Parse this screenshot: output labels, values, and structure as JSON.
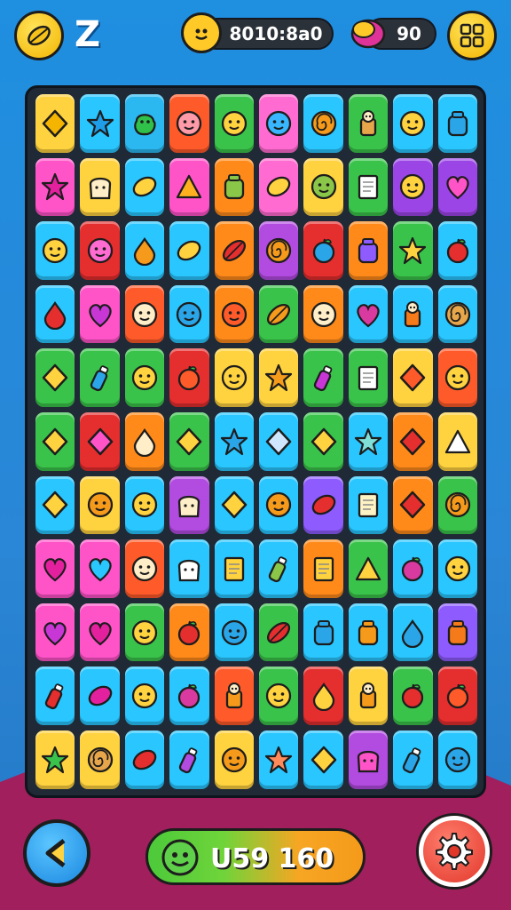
{
  "hud": {
    "top_letter": "Z",
    "score_pill_value": "8010:8a0",
    "gems_pill_value": "90"
  },
  "bottom": {
    "score_value": "U59 160"
  },
  "board": {
    "rows": [
      [
        [
          "#ffd23f",
          "diamond",
          "#f4b400"
        ],
        [
          "#29c6ff",
          "star",
          "#1e9ee8"
        ],
        [
          "#2bb8f0",
          "blob",
          "#2fc14a"
        ],
        [
          "#ff5a2a",
          "face",
          "#ff9aa8"
        ],
        [
          "#3ac34a",
          "face",
          "#ffd23f"
        ],
        [
          "#ff6bd0",
          "face",
          "#38b6ff"
        ],
        [
          "#29c6ff",
          "spiral",
          "#f59a1a"
        ],
        [
          "#3ac34a",
          "figure",
          "#e8a64a"
        ],
        [
          "#29c6ff",
          "face",
          "#ffd23f"
        ],
        [
          "#29c6ff",
          "jar",
          "#2aa6e8"
        ]
      ],
      [
        [
          "#ff53c8",
          "star",
          "#e3209e"
        ],
        [
          "#ffd23f",
          "toast",
          "#ffeec7"
        ],
        [
          "#29c6ff",
          "bean",
          "#ffd23f"
        ],
        [
          "#ff53c8",
          "triangle",
          "#ffb01f"
        ],
        [
          "#ff8a1a",
          "jar",
          "#8ac648"
        ],
        [
          "#ff6bd0",
          "bean",
          "#ffd23f"
        ],
        [
          "#ffd23f",
          "face",
          "#8ac648"
        ],
        [
          "#3ac34a",
          "card",
          "#ffffff"
        ],
        [
          "#9b45e6",
          "face",
          "#ffd23f"
        ],
        [
          "#9b45e6",
          "heart",
          "#ff53c8"
        ]
      ],
      [
        [
          "#29c6ff",
          "face",
          "#ffd23f"
        ],
        [
          "#e52e2e",
          "face",
          "#ff6bd0"
        ],
        [
          "#29c6ff",
          "drop",
          "#f59a1a"
        ],
        [
          "#29c6ff",
          "bean",
          "#ffd23f"
        ],
        [
          "#ff8a1a",
          "leaf",
          "#e52e2e"
        ],
        [
          "#b24be0",
          "spiral",
          "#f59a1a"
        ],
        [
          "#e52e2e",
          "apple",
          "#2aa6e8"
        ],
        [
          "#ff8a1a",
          "jar",
          "#8e5bff"
        ],
        [
          "#3ac34a",
          "star",
          "#ffd23f"
        ],
        [
          "#29c6ff",
          "apple",
          "#e52e2e"
        ]
      ],
      [
        [
          "#29c6ff",
          "drop",
          "#e52e2e"
        ],
        [
          "#ff53c8",
          "heart",
          "#c837d6"
        ],
        [
          "#ff5a2a",
          "face",
          "#ffeec7"
        ],
        [
          "#29c6ff",
          "face",
          "#2aa6e8"
        ],
        [
          "#ff8a1a",
          "face",
          "#ff5a2a"
        ],
        [
          "#3ac34a",
          "leaf",
          "#f59a1a"
        ],
        [
          "#ff8a1a",
          "face",
          "#ffeec7"
        ],
        [
          "#29c6ff",
          "heart",
          "#d83aa0"
        ],
        [
          "#29c6ff",
          "figure",
          "#f57a1a"
        ],
        [
          "#29c6ff",
          "spiral",
          "#e8a64a"
        ]
      ],
      [
        [
          "#3ac34a",
          "diamond",
          "#ffd23f"
        ],
        [
          "#3ac34a",
          "bottle",
          "#2aa6e8"
        ],
        [
          "#3ac34a",
          "face",
          "#ffd23f"
        ],
        [
          "#e52e2e",
          "apple",
          "#ff5a2a"
        ],
        [
          "#ffd23f",
          "face",
          "#ffd23f"
        ],
        [
          "#ffd23f",
          "star",
          "#f59a1a"
        ],
        [
          "#3ac34a",
          "bottle",
          "#c837d6"
        ],
        [
          "#3ac34a",
          "card",
          "#ffffff"
        ],
        [
          "#ffd23f",
          "diamond",
          "#ff5a2a"
        ],
        [
          "#ff5a2a",
          "face",
          "#ffd23f"
        ]
      ],
      [
        [
          "#3ac34a",
          "diamond",
          "#ffd23f"
        ],
        [
          "#e52e2e",
          "diamond",
          "#ff53c8"
        ],
        [
          "#ff8a1a",
          "drop",
          "#ffeec7"
        ],
        [
          "#3ac34a",
          "diamond",
          "#ffd23f"
        ],
        [
          "#29c6ff",
          "star",
          "#2aa6e8"
        ],
        [
          "#29c6ff",
          "diamond",
          "#cfe6ff"
        ],
        [
          "#3ac34a",
          "diamond",
          "#ffd23f"
        ],
        [
          "#29c6ff",
          "star",
          "#7fe0d8"
        ],
        [
          "#ff8a1a",
          "diamond",
          "#e52e2e"
        ],
        [
          "#ffd23f",
          "triangle",
          "#ffffff"
        ]
      ],
      [
        [
          "#29c6ff",
          "diamond",
          "#ffd23f"
        ],
        [
          "#ffd23f",
          "face",
          "#f59a1a"
        ],
        [
          "#29c6ff",
          "face",
          "#ffd23f"
        ],
        [
          "#b24be0",
          "toast",
          "#ffeec7"
        ],
        [
          "#29c6ff",
          "diamond",
          "#ffd23f"
        ],
        [
          "#29c6ff",
          "face",
          "#f59a1a"
        ],
        [
          "#8e5bff",
          "bean",
          "#e52e2e"
        ],
        [
          "#29c6ff",
          "card",
          "#fff3c4"
        ],
        [
          "#ff8a1a",
          "diamond",
          "#e52e2e"
        ],
        [
          "#3ac34a",
          "spiral",
          "#f59a1a"
        ]
      ],
      [
        [
          "#ff53c8",
          "heart",
          "#e3209e"
        ],
        [
          "#ff53c8",
          "heart",
          "#29c6ff"
        ],
        [
          "#ff5a2a",
          "face",
          "#ffeec7"
        ],
        [
          "#29c6ff",
          "toast",
          "#ffffff"
        ],
        [
          "#29c6ff",
          "card",
          "#ffd23f"
        ],
        [
          "#29c6ff",
          "bottle",
          "#8ac648"
        ],
        [
          "#ff8a1a",
          "card",
          "#ffd23f"
        ],
        [
          "#3ac34a",
          "triangle",
          "#ffd23f"
        ],
        [
          "#29c6ff",
          "apple",
          "#d83aa0"
        ],
        [
          "#29c6ff",
          "face",
          "#ffd23f"
        ]
      ],
      [
        [
          "#ff53c8",
          "heart",
          "#c837d6"
        ],
        [
          "#ff53c8",
          "heart",
          "#e3209e"
        ],
        [
          "#3ac34a",
          "face",
          "#ffd23f"
        ],
        [
          "#ff8a1a",
          "apple",
          "#e52e2e"
        ],
        [
          "#29c6ff",
          "face",
          "#2aa6e8"
        ],
        [
          "#3ac34a",
          "leaf",
          "#e52e2e"
        ],
        [
          "#29c6ff",
          "jar",
          "#2aa6e8"
        ],
        [
          "#29c6ff",
          "jar",
          "#f59a1a"
        ],
        [
          "#29c6ff",
          "drop",
          "#2aa6e8"
        ],
        [
          "#8e5bff",
          "jar",
          "#f57a1a"
        ]
      ],
      [
        [
          "#29c6ff",
          "bottle",
          "#e52e2e"
        ],
        [
          "#29c6ff",
          "bean",
          "#e3209e"
        ],
        [
          "#29c6ff",
          "face",
          "#ffd23f"
        ],
        [
          "#29c6ff",
          "apple",
          "#d83aa0"
        ],
        [
          "#ff5a2a",
          "figure",
          "#f59a1a"
        ],
        [
          "#3ac34a",
          "face",
          "#ffd23f"
        ],
        [
          "#e52e2e",
          "drop",
          "#ffd23f"
        ],
        [
          "#ffd23f",
          "figure",
          "#f59a1a"
        ],
        [
          "#3ac34a",
          "apple",
          "#e52e2e"
        ],
        [
          "#e52e2e",
          "apple",
          "#ff5a2a"
        ]
      ],
      [
        [
          "#ffd23f",
          "star",
          "#3ac34a"
        ],
        [
          "#ffd23f",
          "spiral",
          "#e8a64a"
        ],
        [
          "#29c6ff",
          "bean",
          "#e52e2e"
        ],
        [
          "#29c6ff",
          "bottle",
          "#b24be0"
        ],
        [
          "#ffd23f",
          "face",
          "#f59a1a"
        ],
        [
          "#29c6ff",
          "star",
          "#ff8a5a"
        ],
        [
          "#29c6ff",
          "diamond",
          "#ffd23f"
        ],
        [
          "#b24be0",
          "toast",
          "#ff53c8"
        ],
        [
          "#29c6ff",
          "bottle",
          "#2aa6e8"
        ],
        [
          "#29c6ff",
          "face",
          "#2aa6e8"
        ]
      ]
    ]
  }
}
